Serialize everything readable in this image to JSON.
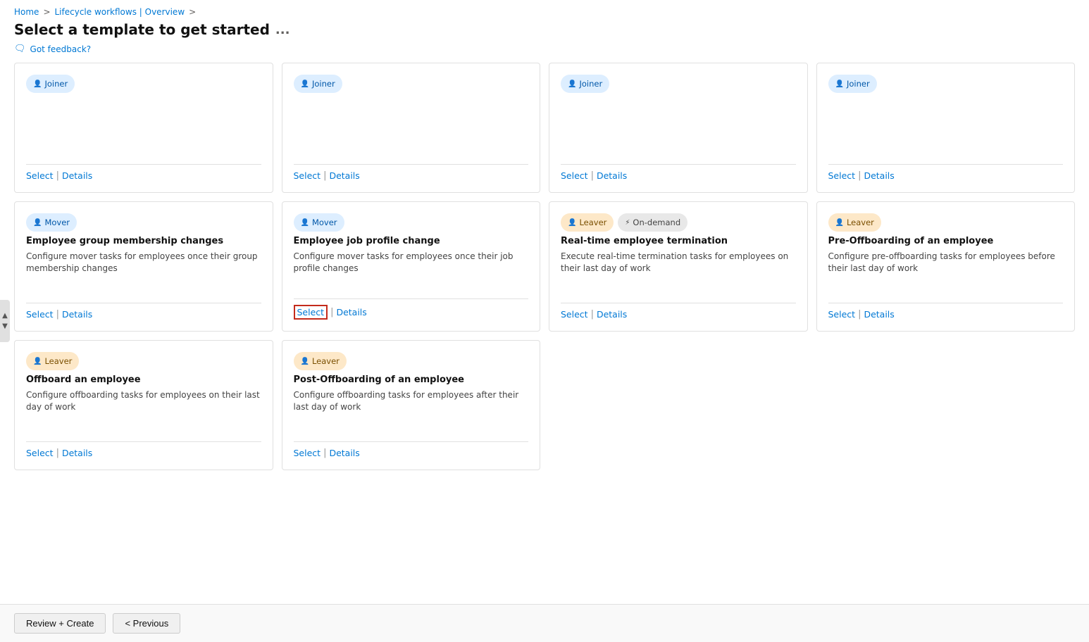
{
  "breadcrumb": {
    "home": "Home",
    "sep1": ">",
    "lifecycle": "Lifecycle workflows | Overview",
    "sep2": ">"
  },
  "page": {
    "title": "Select a template to get started",
    "dots": "...",
    "feedback": "Got feedback?"
  },
  "cards": [
    {
      "id": "card-1",
      "tags": [
        {
          "label": "Joiner",
          "type": "joiner"
        }
      ],
      "title": "",
      "desc": "",
      "select_label": "Select",
      "details_label": "Details",
      "highlighted": false
    },
    {
      "id": "card-2",
      "tags": [
        {
          "label": "Joiner",
          "type": "joiner"
        }
      ],
      "title": "",
      "desc": "",
      "select_label": "Select",
      "details_label": "Details",
      "highlighted": false
    },
    {
      "id": "card-3",
      "tags": [
        {
          "label": "Joiner",
          "type": "joiner"
        }
      ],
      "title": "",
      "desc": "",
      "select_label": "Select",
      "details_label": "Details",
      "highlighted": false
    },
    {
      "id": "card-4",
      "tags": [
        {
          "label": "Joiner",
          "type": "joiner"
        }
      ],
      "title": "",
      "desc": "",
      "select_label": "Select",
      "details_label": "Details",
      "highlighted": false
    },
    {
      "id": "card-5",
      "tags": [
        {
          "label": "Mover",
          "type": "mover"
        }
      ],
      "title": "Employee group membership changes",
      "desc": "Configure mover tasks for employees once their group membership changes",
      "select_label": "Select",
      "details_label": "Details",
      "highlighted": false
    },
    {
      "id": "card-6",
      "tags": [
        {
          "label": "Mover",
          "type": "mover"
        }
      ],
      "title": "Employee job profile change",
      "desc": "Configure mover tasks for employees once their job profile changes",
      "select_label": "Select",
      "details_label": "Details",
      "highlighted": true
    },
    {
      "id": "card-7",
      "tags": [
        {
          "label": "Leaver",
          "type": "leaver"
        },
        {
          "label": "On-demand",
          "type": "ondemand"
        }
      ],
      "title": "Real-time employee termination",
      "desc": "Execute real-time termination tasks for employees on their last day of work",
      "select_label": "Select",
      "details_label": "Details",
      "highlighted": false
    },
    {
      "id": "card-8",
      "tags": [
        {
          "label": "Leaver",
          "type": "leaver"
        }
      ],
      "title": "Pre-Offboarding of an employee",
      "desc": "Configure pre-offboarding tasks for employees before their last day of work",
      "select_label": "Select",
      "details_label": "Details",
      "highlighted": false
    },
    {
      "id": "card-9",
      "tags": [
        {
          "label": "Leaver",
          "type": "leaver"
        }
      ],
      "title": "Offboard an employee",
      "desc": "Configure offboarding tasks for employees on their last day of work",
      "select_label": "Select",
      "details_label": "Details",
      "highlighted": false
    },
    {
      "id": "card-10",
      "tags": [
        {
          "label": "Leaver",
          "type": "leaver"
        }
      ],
      "title": "Post-Offboarding of an employee",
      "desc": "Configure offboarding tasks for employees after their last day of work",
      "select_label": "Select",
      "details_label": "Details",
      "highlighted": false
    }
  ],
  "bottom": {
    "review_create": "Review + Create",
    "previous": "< Previous"
  }
}
